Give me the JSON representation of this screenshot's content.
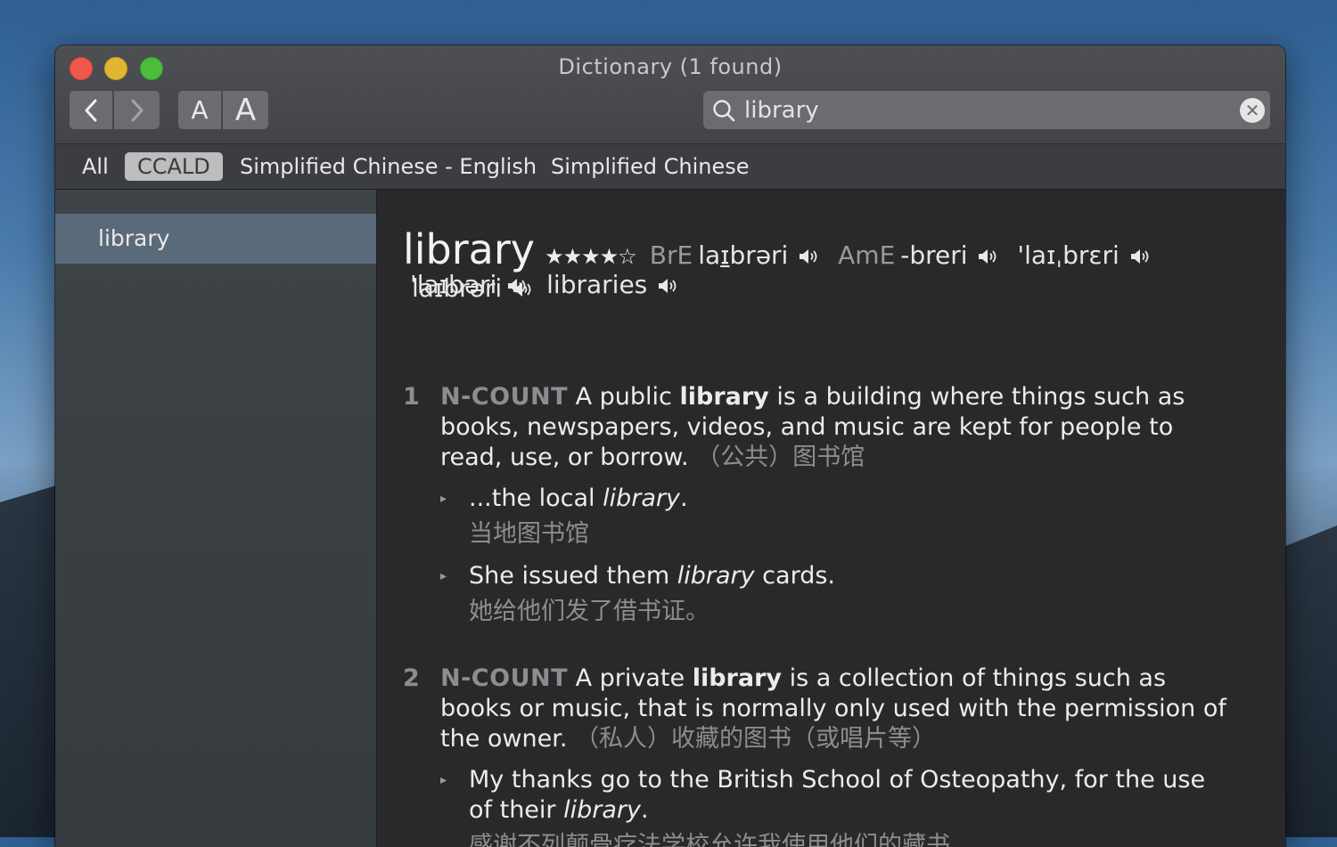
{
  "window": {
    "title": "Dictionary (1 found)"
  },
  "toolbar": {
    "back_icon": "chevron-left-icon",
    "forward_icon": "chevron-right-icon",
    "font_smaller_label": "A",
    "font_larger_label": "A",
    "search_value": "library",
    "search_icon": "search-icon",
    "clear_icon": "clear-icon"
  },
  "tabs": [
    {
      "label": "All",
      "active": false
    },
    {
      "label": "CCALD",
      "active": true
    },
    {
      "label": "Simplified Chinese - English",
      "active": false
    },
    {
      "label": "Simplified Chinese",
      "active": false
    }
  ],
  "sidebar": {
    "items": [
      {
        "label": "library",
        "selected": true
      }
    ]
  },
  "entry": {
    "headword": "library",
    "stars": "★★★★☆",
    "pronunciations": [
      {
        "label": "BrE",
        "ipa_pre": "la",
        "ipa_ul": "ɪ",
        "ipa_post": "brəri"
      },
      {
        "label": "AmE",
        "ipa": "-breri"
      },
      {
        "ipa": "'laɪˌbrɛri"
      },
      {
        "ipa": "laɪbrəri"
      },
      {
        "ipa": "'laɪbəri"
      },
      {
        "ipa": "libraries"
      }
    ],
    "senses": [
      {
        "num": "1",
        "pos": "N-COUNT",
        "def_pre": "A public ",
        "def_bold": "library",
        "def_post": " is a building where things such as books, newspapers, videos, and music are kept for people to read, use, or borrow.",
        "zh": "（公共）图书馆",
        "examples": [
          {
            "pre": "...the local ",
            "it": "library",
            "post": ".",
            "zh": "当地图书馆"
          },
          {
            "pre": "She issued them ",
            "it": "library",
            "post": " cards.",
            "zh": "她给他们发了借书证。"
          }
        ]
      },
      {
        "num": "2",
        "pos": "N-COUNT",
        "def_pre": "A private ",
        "def_bold": "library",
        "def_post": " is a collection of things such as books or music, that is normally only used with the permission of the owner.",
        "zh": "（私人）收藏的图书（或唱片等）",
        "examples": [
          {
            "pre": "My thanks go to the British School of Osteopathy, for the use of their ",
            "it": "library",
            "post": ".",
            "zh": "感谢不列颠骨疗法学校允许我使用他们的藏书。"
          }
        ]
      }
    ]
  },
  "colors": {
    "accent_selection": "#5b6a7a",
    "close": "#f0584e",
    "minimize": "#e2b632",
    "zoom": "#4dbb3c"
  }
}
